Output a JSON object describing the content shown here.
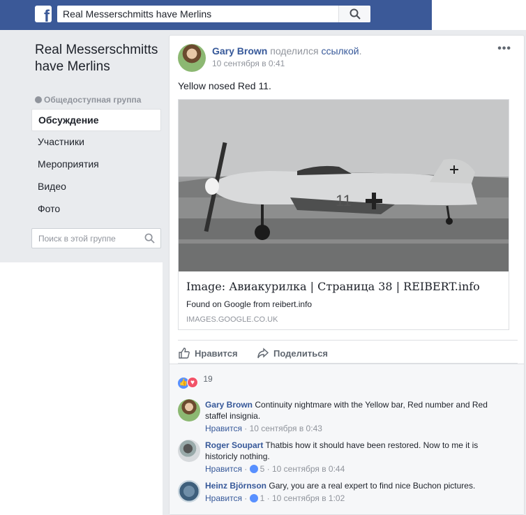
{
  "topbar": {
    "logo": "f",
    "search_value": "Real Messerschmitts have Merlins",
    "search_icon": "search-icon"
  },
  "sidebar": {
    "group_name": "Real Messerschmitts have Merlins",
    "group_type": "Общедоступная группа",
    "items": [
      {
        "label": "Обсуждение",
        "active": true
      },
      {
        "label": "Участники"
      },
      {
        "label": "Мероприятия"
      },
      {
        "label": "Видео"
      },
      {
        "label": "Фото"
      }
    ],
    "search_placeholder": "Поиск в этой группе"
  },
  "post": {
    "author": "Gary Brown",
    "shared_text": "поделился",
    "link_text": "ссылкой",
    "date": "10 сентября в 0:41",
    "text": "Yellow nosed Red 11.",
    "link": {
      "title": "Image: Авиакурилка | Страница 38 | REIBERT.info",
      "description": "Found on Google from reibert.info",
      "domain": "IMAGES.GOOGLE.CO.UK"
    },
    "actions": {
      "like": "Нравится",
      "share": "Поделиться"
    },
    "reactions_count": "19"
  },
  "comments": [
    {
      "author": "Gary Brown",
      "text": "Continuity nightmare with the Yellow bar, Red number and Red staffel insignia.",
      "like_label": "Нравится",
      "likes": "",
      "date": "10 сентября в 0:43"
    },
    {
      "author": "Roger Soupart",
      "text": "Thatbis how it should have been restored. Now to me it is historicly nothing.",
      "like_label": "Нравится",
      "likes": "5",
      "date": "10 сентября в 0:44"
    },
    {
      "author": "Heinz Björnson",
      "text": "Gary, you are a real expert to find nice Buchon pictures.",
      "like_label": "Нравится",
      "likes": "1",
      "date": "10 сентября в 1:02"
    }
  ],
  "colors": {
    "brand": "#3b5998",
    "link": "#365899",
    "background": "#e9ebee"
  }
}
